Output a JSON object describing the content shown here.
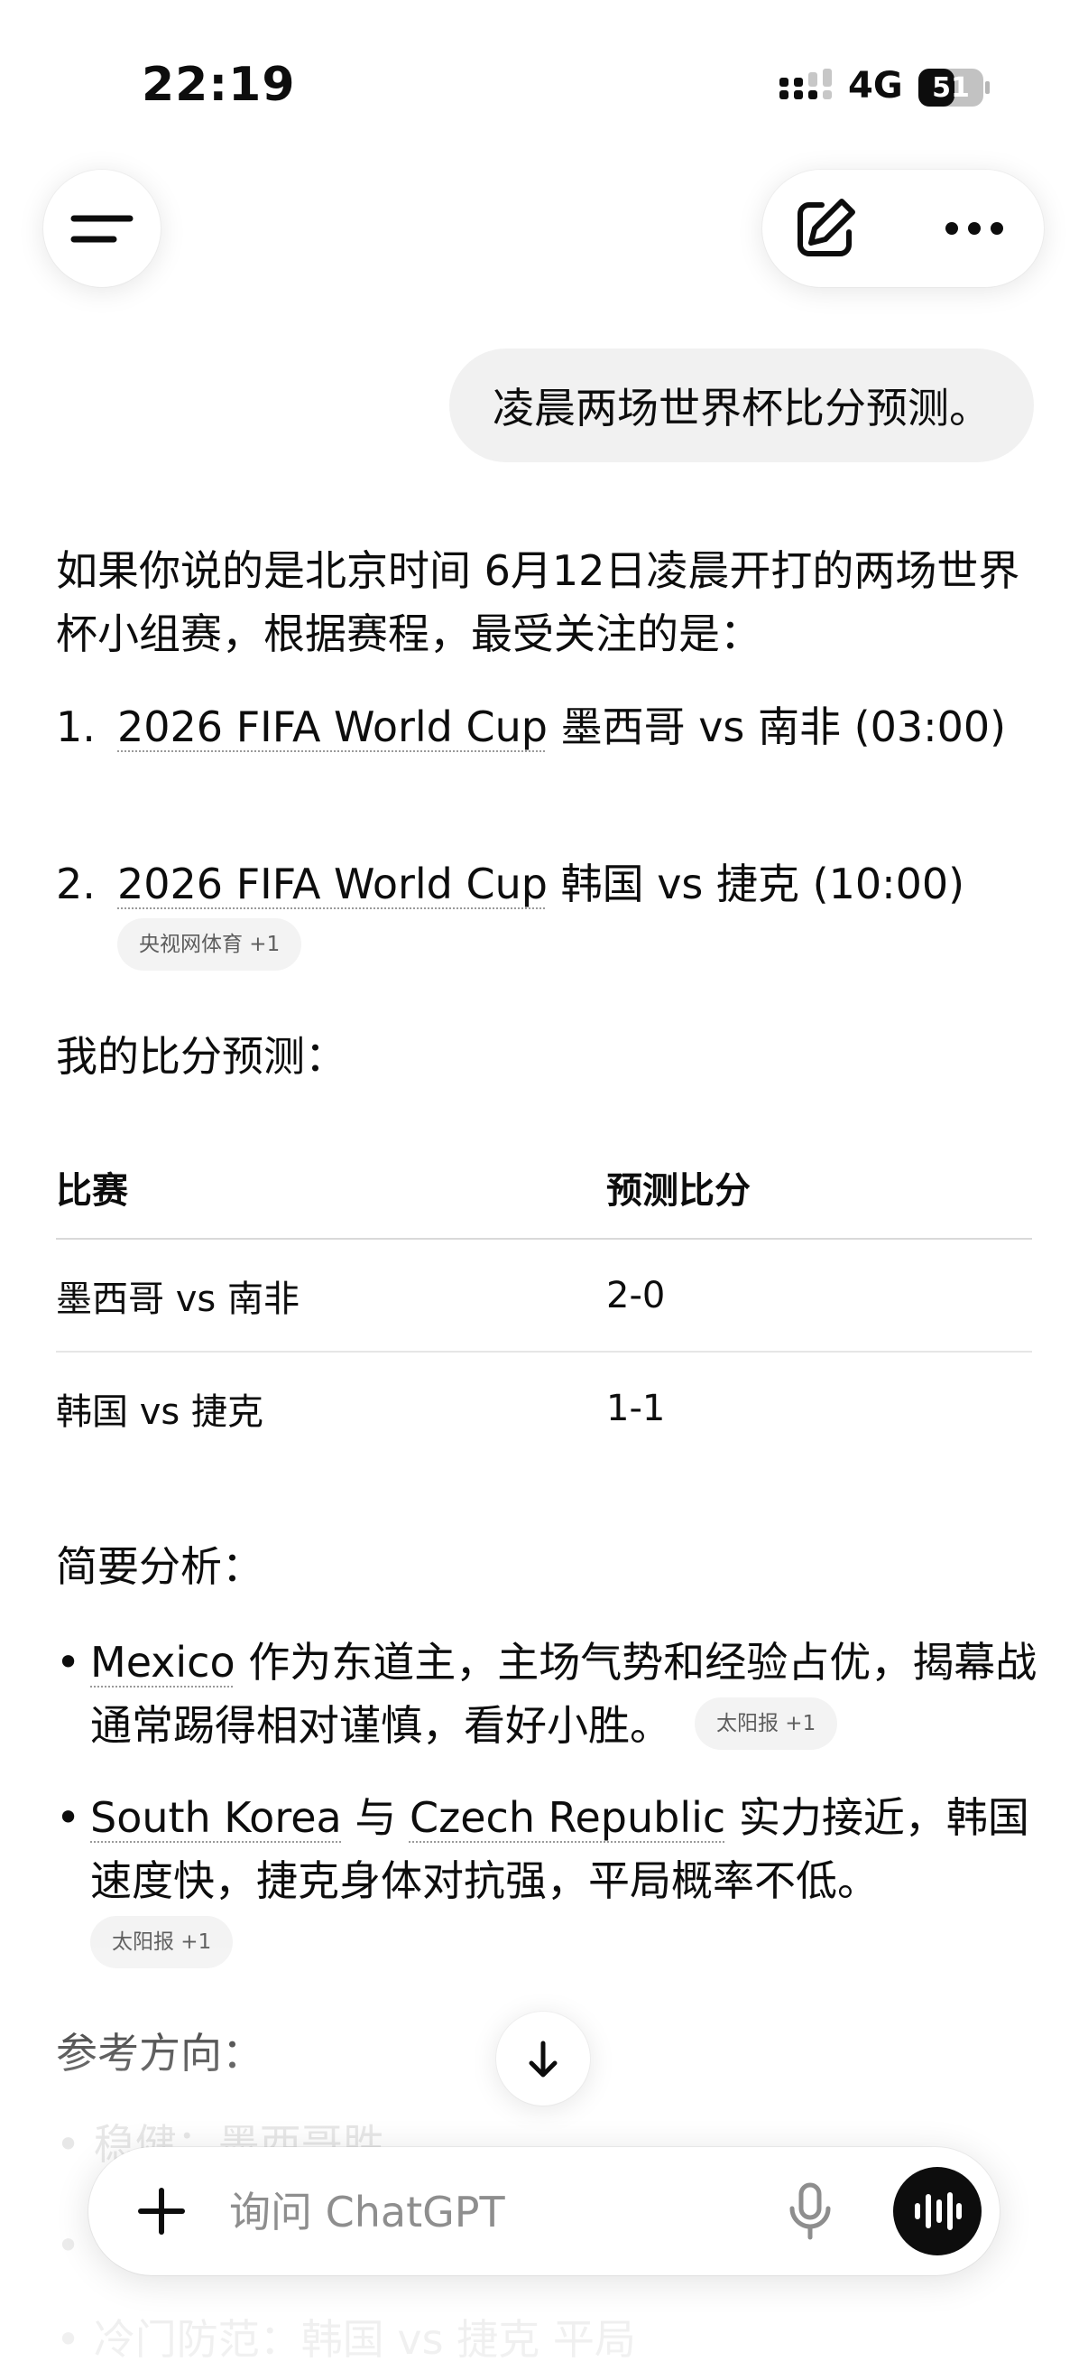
{
  "status_bar": {
    "time": "22:19",
    "network": "4G",
    "battery": "51"
  },
  "header": {
    "menu_icon": "hamburger-icon",
    "new_chat_icon": "edit-icon",
    "more_icon": "ellipsis-icon"
  },
  "user_message": "凌晨两场世界杯比分预测。",
  "response": {
    "intro": "如果你说的是北京时间 6月12日凌晨开打的两场世界杯小组赛，根据赛程，最受关注的是：",
    "list": [
      {
        "num": "1.",
        "link": "2026 FIFA World Cup",
        "text": " 墨西哥 vs 南非 (03:00)"
      },
      {
        "num": "2.",
        "link": "2026 FIFA World Cup",
        "text": " 韩国 vs 捷克 (10:00)",
        "source": "央视网体育 +1"
      }
    ],
    "prediction_heading": "我的比分预测：",
    "table": {
      "headers": [
        "比赛",
        "预测比分"
      ],
      "rows": [
        [
          "墨西哥 vs 南非",
          "2-0"
        ],
        [
          "韩国 vs 捷克",
          "1-1"
        ]
      ]
    },
    "analysis_heading": "简要分析：",
    "analysis": [
      {
        "link1": "Mexico",
        "text": " 作为东道主，主场气势和经验占优，揭幕战通常踢得相对谨慎，看好小胜。",
        "source": "太阳报 +1"
      },
      {
        "link1": "South Korea",
        "mid": " 与 ",
        "link2": "Czech Republic",
        "text": " 实力接近，韩国速度快，捷克身体对抗强，平局概率不低。",
        "source": "太阳报 +1"
      }
    ],
    "reference_heading": "参考方向：",
    "reference": [
      "稳健：墨西哥胜",
      "冷门防范：韩国 vs 捷克 平局"
    ]
  },
  "composer": {
    "placeholder": "询问 ChatGPT",
    "plus_icon": "plus-icon",
    "mic_icon": "mic-icon",
    "voice_icon": "voice-waveform-icon",
    "scroll_icon": "arrow-down-icon"
  }
}
